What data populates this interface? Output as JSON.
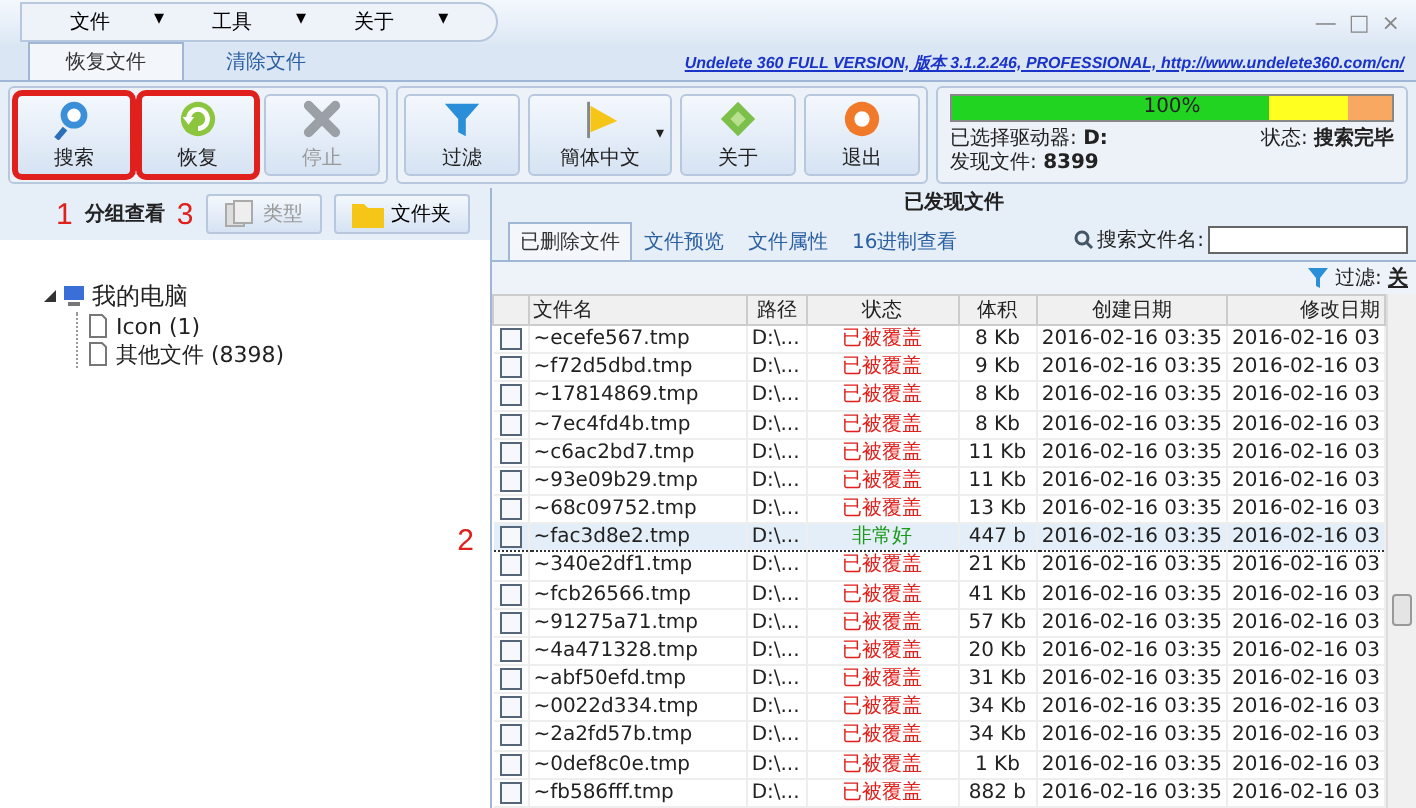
{
  "menu": [
    {
      "label": "文件",
      "arrow": "▾"
    },
    {
      "label": "工具",
      "arrow": "▾"
    },
    {
      "label": "关于",
      "arrow": "▾"
    }
  ],
  "window_controls": [
    "—",
    "□",
    "×"
  ],
  "ribbon_tabs": [
    {
      "label": "恢复文件",
      "selected": true
    },
    {
      "label": "清除文件",
      "selected": false
    }
  ],
  "version_link": "Undelete 360 FULL VERSION, 版本 3.1.2.246, PROFESSIONAL, http://www.undelete360.com/cn/",
  "toolbar_groups": [
    [
      {
        "label": "搜索",
        "disabled": false,
        "highlighted": true
      },
      {
        "label": "恢复",
        "disabled": false,
        "highlighted": true
      },
      {
        "label": "停止",
        "disabled": true,
        "highlighted": false
      }
    ],
    [
      {
        "label": "过滤",
        "disabled": false,
        "highlighted": false
      },
      {
        "label": "簡体中文",
        "disabled": false,
        "highlighted": false,
        "dropdown": "▾"
      },
      {
        "label": "关于",
        "disabled": false,
        "highlighted": false
      },
      {
        "label": "退出",
        "disabled": false,
        "highlighted": false
      }
    ]
  ],
  "status_panel": {
    "progress": {
      "level": 1,
      "reading": "100%"
    },
    "drive_label": "已选择驱动器:",
    "drive": "D:",
    "found_label": "发现文件:",
    "found": "8399",
    "state_label": "状态:",
    "state": "搜索完毕"
  },
  "group_view": {
    "annotation_before": "1",
    "label": "分组查看",
    "annotation_after": "3",
    "buttons": [
      {
        "label": "类型",
        "disabled": true
      },
      {
        "label": "文件夹",
        "disabled": false
      }
    ]
  },
  "tree": [
    {
      "label": "我的电脑",
      "expanded": true,
      "children": [
        {
          "label": "Icon (1)"
        },
        {
          "label": "其他文件 (8398)"
        }
      ]
    }
  ],
  "side_annotation": "2",
  "files_panel": {
    "title": "已发现文件",
    "tabs": [
      {
        "label": "已删除文件",
        "selected": true
      },
      {
        "label": "文件预览",
        "selected": false
      },
      {
        "label": "文件属性",
        "selected": false
      },
      {
        "label": "16进制查看",
        "selected": false
      }
    ],
    "search_label": "搜索文件名:",
    "filter_label": "过滤:",
    "filter_value": "关",
    "columns": [
      "文件名",
      "路径",
      "状态",
      "体积",
      "创建日期",
      "修改日期"
    ],
    "rows": [
      {
        "checked": false,
        "selected": false,
        "name": "~ecefe567.tmp",
        "path": "D:\\...",
        "status": "已被覆盖",
        "kind": "overwritten",
        "size": "8 Kb",
        "created": "2016-02-16 03:35",
        "modified": "2016-02-16 03"
      },
      {
        "checked": false,
        "selected": false,
        "name": "~f72d5dbd.tmp",
        "path": "D:\\...",
        "status": "已被覆盖",
        "kind": "overwritten",
        "size": "9 Kb",
        "created": "2016-02-16 03:35",
        "modified": "2016-02-16 03"
      },
      {
        "checked": false,
        "selected": false,
        "name": "~17814869.tmp",
        "path": "D:\\...",
        "status": "已被覆盖",
        "kind": "overwritten",
        "size": "8 Kb",
        "created": "2016-02-16 03:35",
        "modified": "2016-02-16 03"
      },
      {
        "checked": false,
        "selected": false,
        "name": "~7ec4fd4b.tmp",
        "path": "D:\\...",
        "status": "已被覆盖",
        "kind": "overwritten",
        "size": "8 Kb",
        "created": "2016-02-16 03:35",
        "modified": "2016-02-16 03"
      },
      {
        "checked": false,
        "selected": false,
        "name": "~c6ac2bd7.tmp",
        "path": "D:\\...",
        "status": "已被覆盖",
        "kind": "overwritten",
        "size": "11 Kb",
        "created": "2016-02-16 03:35",
        "modified": "2016-02-16 03"
      },
      {
        "checked": false,
        "selected": false,
        "name": "~93e09b29.tmp",
        "path": "D:\\...",
        "status": "已被覆盖",
        "kind": "overwritten",
        "size": "11 Kb",
        "created": "2016-02-16 03:35",
        "modified": "2016-02-16 03"
      },
      {
        "checked": false,
        "selected": false,
        "name": "~68c09752.tmp",
        "path": "D:\\...",
        "status": "已被覆盖",
        "kind": "overwritten",
        "size": "13 Kb",
        "created": "2016-02-16 03:35",
        "modified": "2016-02-16 03"
      },
      {
        "checked": false,
        "selected": true,
        "name": "~fac3d8e2.tmp",
        "path": "D:\\...",
        "status": "非常好",
        "kind": "good",
        "size": "447 b",
        "created": "2016-02-16 03:35",
        "modified": "2016-02-16 03"
      },
      {
        "checked": false,
        "selected": false,
        "name": "~340e2df1.tmp",
        "path": "D:\\...",
        "status": "已被覆盖",
        "kind": "overwritten",
        "size": "21 Kb",
        "created": "2016-02-16 03:35",
        "modified": "2016-02-16 03"
      },
      {
        "checked": false,
        "selected": false,
        "name": "~fcb26566.tmp",
        "path": "D:\\...",
        "status": "已被覆盖",
        "kind": "overwritten",
        "size": "41 Kb",
        "created": "2016-02-16 03:35",
        "modified": "2016-02-16 03"
      },
      {
        "checked": false,
        "selected": false,
        "name": "~91275a71.tmp",
        "path": "D:\\...",
        "status": "已被覆盖",
        "kind": "overwritten",
        "size": "57 Kb",
        "created": "2016-02-16 03:35",
        "modified": "2016-02-16 03"
      },
      {
        "checked": false,
        "selected": false,
        "name": "~4a471328.tmp",
        "path": "D:\\...",
        "status": "已被覆盖",
        "kind": "overwritten",
        "size": "20 Kb",
        "created": "2016-02-16 03:35",
        "modified": "2016-02-16 03"
      },
      {
        "checked": false,
        "selected": false,
        "name": "~abf50efd.tmp",
        "path": "D:\\...",
        "status": "已被覆盖",
        "kind": "overwritten",
        "size": "31 Kb",
        "created": "2016-02-16 03:35",
        "modified": "2016-02-16 03"
      },
      {
        "checked": false,
        "selected": false,
        "name": "~0022d334.tmp",
        "path": "D:\\...",
        "status": "已被覆盖",
        "kind": "overwritten",
        "size": "34 Kb",
        "created": "2016-02-16 03:35",
        "modified": "2016-02-16 03"
      },
      {
        "checked": false,
        "selected": false,
        "name": "~2a2fd57b.tmp",
        "path": "D:\\...",
        "status": "已被覆盖",
        "kind": "overwritten",
        "size": "34 Kb",
        "created": "2016-02-16 03:35",
        "modified": "2016-02-16 03"
      },
      {
        "checked": false,
        "selected": false,
        "name": "~0def8c0e.tmp",
        "path": "D:\\...",
        "status": "已被覆盖",
        "kind": "overwritten",
        "size": "1 Kb",
        "created": "2016-02-16 03:35",
        "modified": "2016-02-16 03"
      },
      {
        "checked": false,
        "selected": false,
        "name": "~fb586fff.tmp",
        "path": "D:\\...",
        "status": "已被覆盖",
        "kind": "overwritten",
        "size": "882 b",
        "created": "2016-02-16 03:35",
        "modified": "2016-02-16 03"
      }
    ]
  }
}
